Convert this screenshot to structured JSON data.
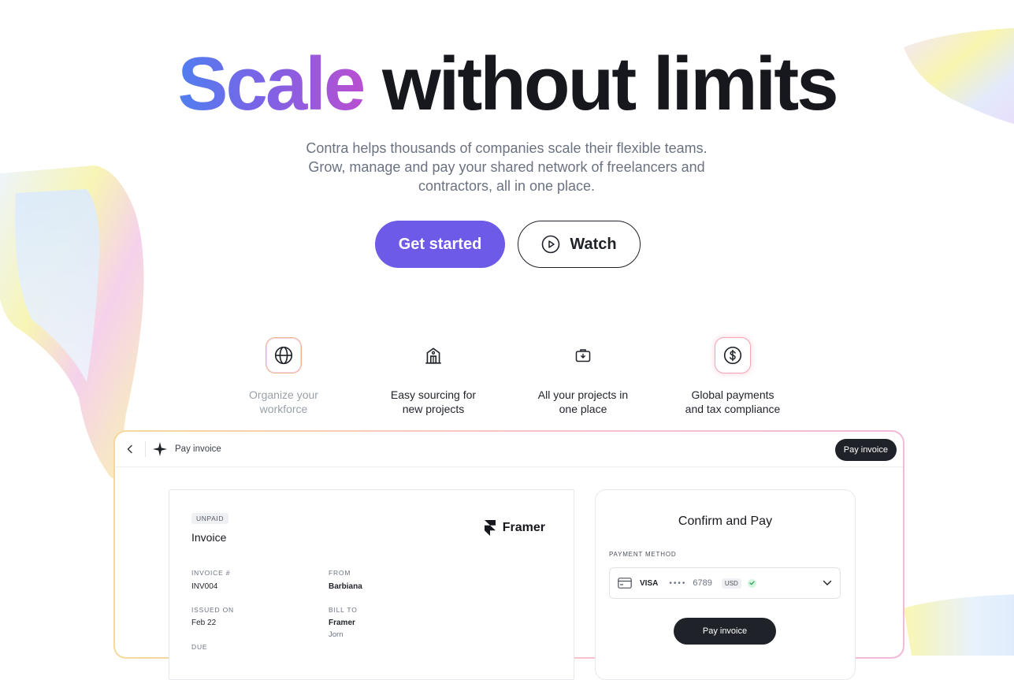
{
  "hero": {
    "title_gradient": "Scale",
    "title_rest": "without limits",
    "subtitle_line1": "Contra helps thousands of companies scale their flexible teams.",
    "subtitle_line2": "Grow, manage and pay your shared network of freelancers and",
    "subtitle_line3": "contractors, all in one place.",
    "cta_primary": "Get started",
    "cta_secondary": "Watch",
    "gradient_colors": [
      "#4f7ff0",
      "#7b63e6",
      "#b94fd1"
    ],
    "accent": "#6d5ae6"
  },
  "features": [
    {
      "icon": "globe-icon",
      "line1": "Organize your",
      "line2": "workforce",
      "active": false
    },
    {
      "icon": "building-icon",
      "line1": "Easy sourcing for",
      "line2": "new projects",
      "active": false
    },
    {
      "icon": "briefcase-icon",
      "line1": "All your projects in",
      "line2": "one place",
      "active": false
    },
    {
      "icon": "dollar-icon",
      "line1": "Global payments",
      "line2": "and tax compliance",
      "active": true
    }
  ],
  "app": {
    "topbar_title": "Pay invoice",
    "topbar_button": "Pay invoice",
    "invoice": {
      "status": "UNPAID",
      "title": "Invoice",
      "brand": "Framer",
      "invoice_no_label": "INVOICE #",
      "invoice_no": "INV004",
      "from_label": "FROM",
      "from": "Barbiana",
      "issued_label": "ISSUED ON",
      "issued": "Feb 22",
      "bill_to_label": "BILL TO",
      "bill_to": "Framer",
      "bill_to_contact": "Jorn",
      "due_label": "DUE"
    },
    "payment": {
      "title": "Confirm and Pay",
      "method_label": "PAYMENT METHOD",
      "card_brand": "VISA",
      "card_dots": "••••",
      "card_last4": "6789",
      "currency": "USD",
      "button": "Pay invoice"
    }
  }
}
